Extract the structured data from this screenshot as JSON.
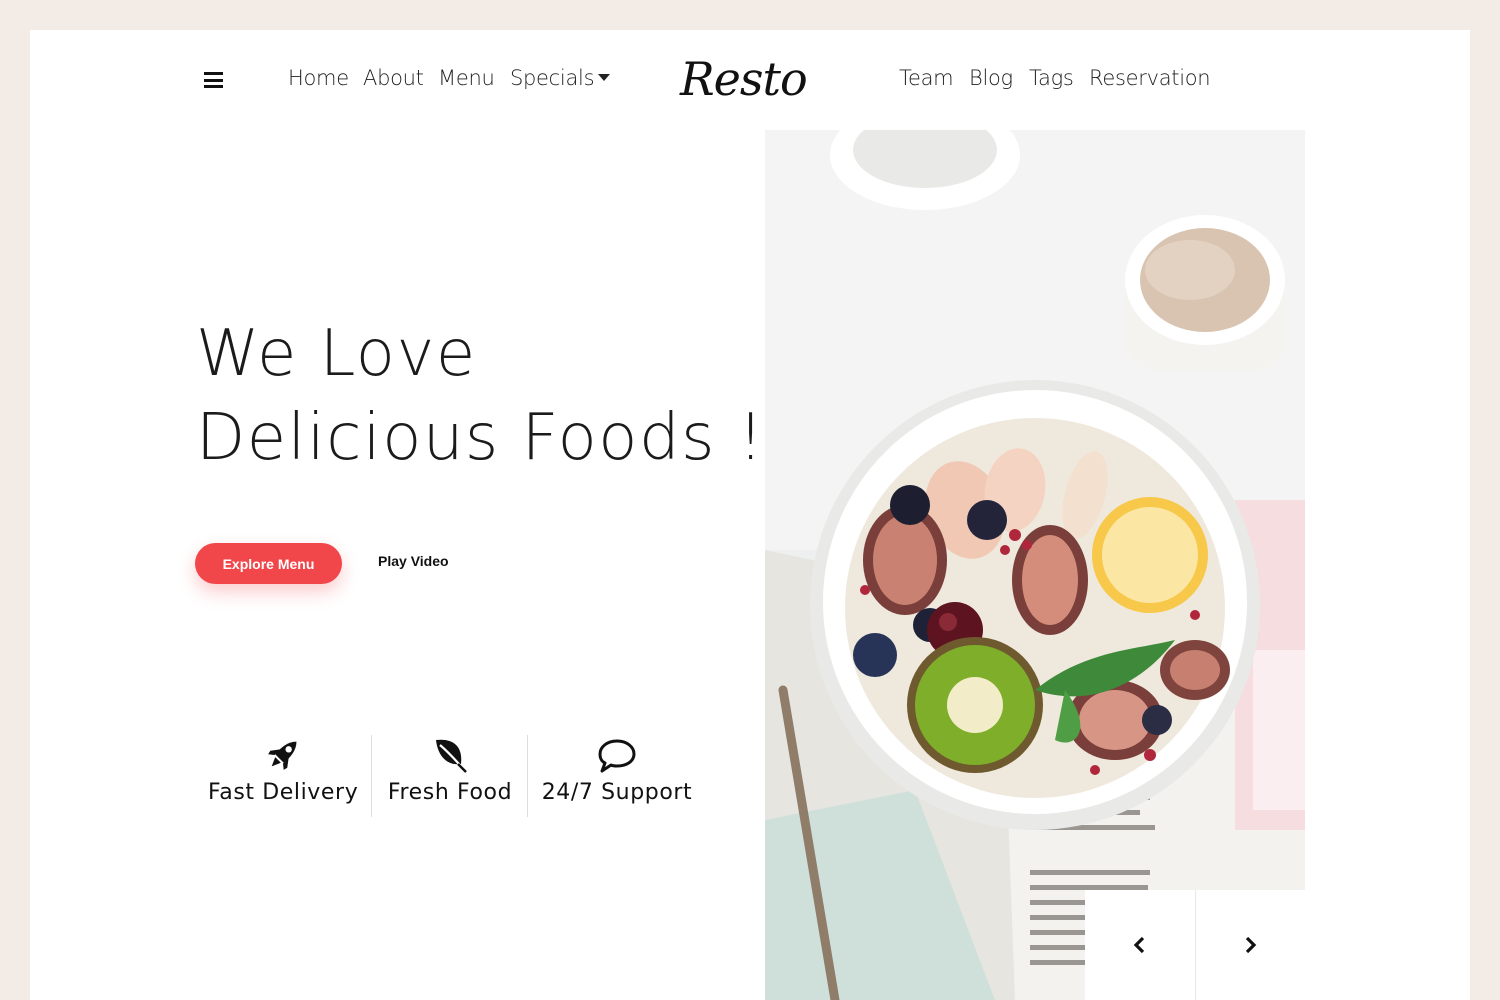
{
  "brand": {
    "logo": "Resto"
  },
  "nav": {
    "left": [
      {
        "label": "Home"
      },
      {
        "label": "About"
      },
      {
        "label": "Menu"
      },
      {
        "label": "Specials",
        "dropdown": true
      }
    ],
    "right": [
      {
        "label": "Team"
      },
      {
        "label": "Blog"
      },
      {
        "label": "Tags"
      },
      {
        "label": "Reservation"
      }
    ]
  },
  "hero": {
    "title_line1": "We Love",
    "title_line2": "Delicious Foods !",
    "primary_button": "Explore Menu",
    "secondary_button": "Play Video"
  },
  "features": [
    {
      "icon": "rocket-icon",
      "label": "Fast Delivery"
    },
    {
      "icon": "leaf-icon",
      "label": "Fresh Food"
    },
    {
      "icon": "chat-bubble-icon",
      "label": "24/7 Support"
    }
  ],
  "slider": {
    "prev_icon": "chevron-left-icon",
    "next_icon": "chevron-right-icon"
  },
  "colors": {
    "page_background": "#f3ece6",
    "accent": "#f1474b",
    "text": "#1b1b1b"
  }
}
